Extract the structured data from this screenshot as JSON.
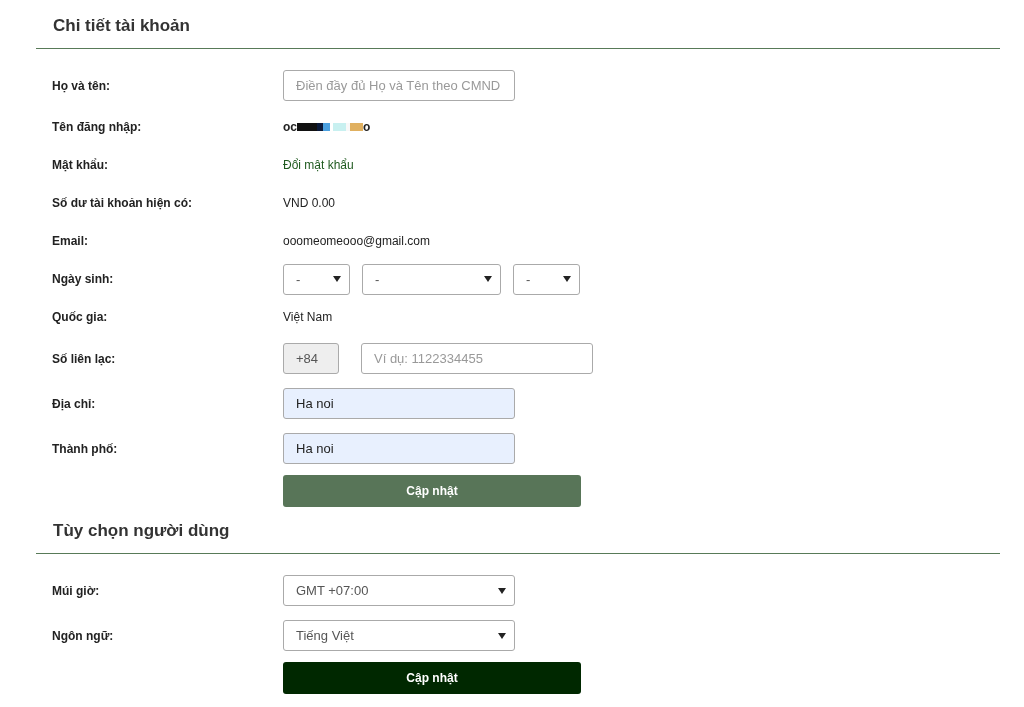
{
  "sections": [
    {
      "title": "Chi tiết tài khoản",
      "rows": [
        {
          "kind": "input",
          "label": "Họ và tên:",
          "placeholder": "Điền đầy đủ Họ và Tên theo CMND",
          "autofilled": false
        },
        {
          "kind": "redacted",
          "label": "Tên đăng nhập:",
          "prefix": "oc",
          "suffix": "o"
        },
        {
          "kind": "link",
          "label": "Mật khẩu:",
          "value": "Đổi mật khẩu"
        },
        {
          "kind": "text",
          "label": "Số dư tài khoản hiện có:",
          "value": "VND 0.00"
        },
        {
          "kind": "text",
          "label": "Email:",
          "value": "ooomeomeooo@gmail.com"
        },
        {
          "kind": "date",
          "label": "Ngày sinh:",
          "selects": [
            "-",
            "-",
            "-"
          ]
        },
        {
          "kind": "text",
          "label": "Quốc gia:",
          "value": "Việt Nam"
        },
        {
          "kind": "phone",
          "label": "Số liên lạc:",
          "prefix": "+84",
          "placeholder": "Ví dụ: 1122334455"
        },
        {
          "kind": "input",
          "label": "Địa chỉ:",
          "value": "Ha noi",
          "autofilled": true
        },
        {
          "kind": "input",
          "label": "Thành phố:",
          "value": "Ha noi",
          "autofilled": true
        }
      ],
      "button": {
        "label": "Cập nhật",
        "disabled": true
      }
    },
    {
      "title": "Tùy chọn người dùng",
      "rows": [
        {
          "kind": "select",
          "label": "Múi giờ:",
          "value": "GMT +07:00"
        },
        {
          "kind": "select",
          "label": "Ngôn ngữ:",
          "value": "Tiếng Việt"
        }
      ],
      "button": {
        "label": "Cập nhật",
        "disabled": false
      }
    }
  ]
}
